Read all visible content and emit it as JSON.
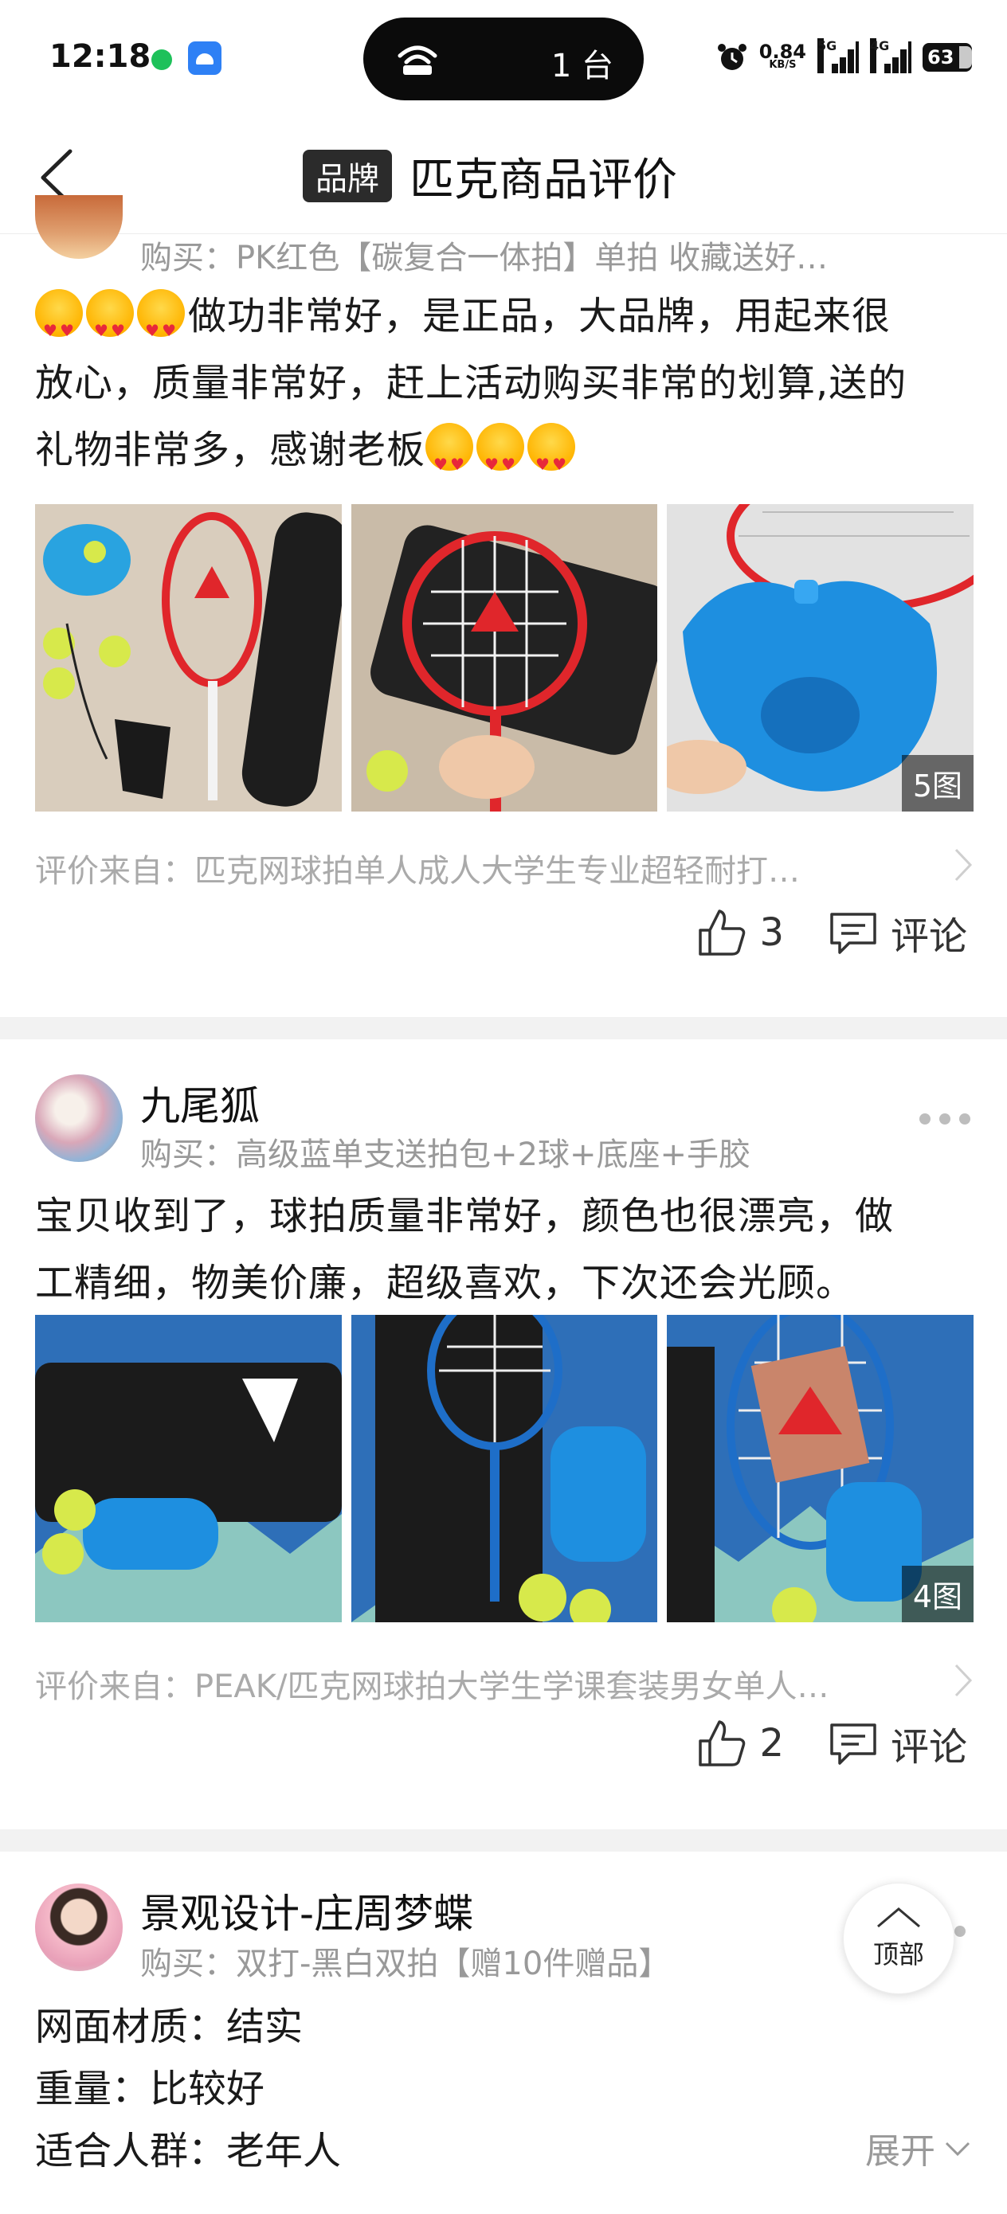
{
  "status_bar": {
    "time": "12:18",
    "island_text": "1 台",
    "net_speed": "0.84",
    "net_speed_unit": "KB/S",
    "sig1_gen": "5G",
    "sig2_gen": "4G",
    "battery": "63"
  },
  "nav": {
    "brand_tag": "品牌",
    "title": "匹克商品评价"
  },
  "reviews": [
    {
      "bought": "购买：PK红色【碳复合一体拍】单拍 收藏送好…",
      "text_line1": "做功非常好，是正品，大品牌，用起来很",
      "text_line2": "放心，质量非常好，赶上活动购买非常的划算,送的",
      "text_line3": "礼物非常多，感谢老板",
      "photo_count": "5图",
      "source": "评价来自：匹克网球拍单人成人大学生专业超轻耐打…",
      "likes": "3",
      "comment_label": "评论"
    },
    {
      "username": "九尾狐",
      "bought": "购买：高级蓝单支送拍包+2球+底座+手胶",
      "text_line1": "宝贝收到了，球拍质量非常好，颜色也很漂亮，做",
      "text_line2": "工精细，物美价廉，超级喜欢，下次还会光顾。",
      "photo_count": "4图",
      "source": "评价来自：PEAK/匹克网球拍大学生学课套装男女单人…",
      "likes": "2",
      "comment_label": "评论"
    },
    {
      "username": "景观设计-庄周梦蝶",
      "bought": "购买：双打-黑白双拍【赠10件赠品】",
      "attrs": [
        {
          "label": "网面材质：",
          "value": "结实"
        },
        {
          "label": "重量：",
          "value": "比较好"
        },
        {
          "label": "适合人群：",
          "value": "老年人"
        }
      ],
      "expand_label": "展开"
    }
  ],
  "float_top_label": "顶部",
  "colors": {
    "brand_tag_bg": "#2b2b2b",
    "muted_text": "#999999",
    "divider": "#f2f2f2"
  }
}
